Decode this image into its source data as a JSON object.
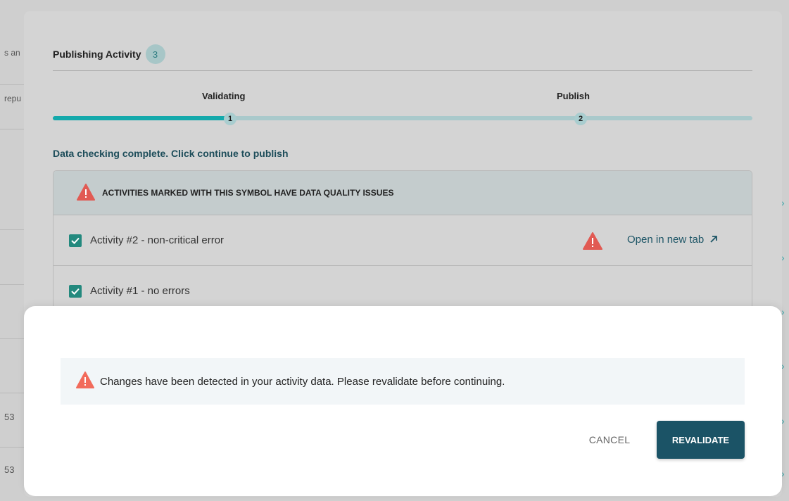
{
  "background": {
    "fragments": [
      "s an",
      "repu",
      "53 ",
      "53 "
    ]
  },
  "modal": {
    "title": "Publishing Activity",
    "count": "3",
    "steps": [
      {
        "label": "Validating",
        "number": "1"
      },
      {
        "label": "Publish",
        "number": "2"
      }
    ],
    "progress_fraction": 0.25,
    "check_message": "Data checking complete. Click continue to publish",
    "issues_header": "ACTIVITIES MARKED WITH THIS SYMBOL HAVE DATA QUALITY ISSUES",
    "activities": [
      {
        "label": "Activity #2 - non-critical error",
        "checked": true,
        "has_issue": true,
        "link": "Open in new tab"
      },
      {
        "label": "Activity #1 - no errors",
        "checked": true,
        "has_issue": false
      }
    ]
  },
  "dialog": {
    "message": "Changes have been detected in your activity data. Please revalidate before continuing.",
    "cancel_label": "CANCEL",
    "revalidate_label": "REVALIDATE"
  },
  "colors": {
    "accent": "#14a9ab",
    "primary": "#1b5366",
    "warning": "#e15a53",
    "checkbox": "#23897e"
  },
  "icons": {
    "warning": "warning-triangle-icon",
    "check": "checkmark-icon",
    "external": "arrow-up-right-icon"
  }
}
